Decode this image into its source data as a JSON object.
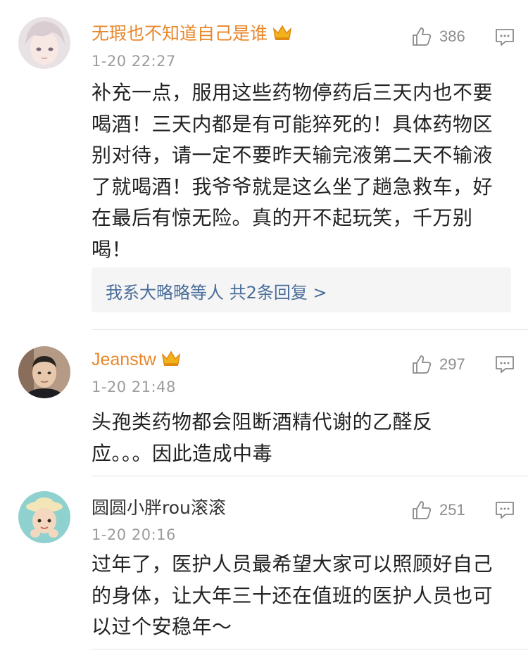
{
  "comments": [
    {
      "username": "无瑕也不知道自己是谁",
      "vip": true,
      "timestamp": "1-20 22:27",
      "likes": "386",
      "text": "补充一点，服用这些药物停药后三天内也不要喝酒！三天内都是有可能猝死的！具体药物区别对待，请一定不要昨天输完液第二天不输液了就喝酒！我爷爷就是这么坐了趟急救车，好在最后有惊无险。真的开不起玩笑，千万别喝！",
      "replies_text": "我系大略略等人  共2条回复 >"
    },
    {
      "username": "Jeanstw",
      "vip": true,
      "timestamp": "1-20 21:48",
      "likes": "297",
      "text": "头孢类药物都会阻断酒精代谢的乙醛反应。。。因此造成中毒"
    },
    {
      "username": "圆圆小胖rou滚滚",
      "vip": false,
      "timestamp": "1-20 20:16",
      "likes": "251",
      "text": "过年了，医护人员最希望大家可以照顾好自己的身体，让大年三十还在值班的医护人员也可以过个安稳年～"
    }
  ],
  "colors": {
    "vip_name": "#e8872a",
    "timestamp": "#9c9c9c",
    "reply_link": "#4a6e9a",
    "reply_bg": "#f5f5f5"
  },
  "icons": {
    "like": "thumbs-up-icon",
    "reply": "comment-icon",
    "vip": "crown-icon"
  }
}
